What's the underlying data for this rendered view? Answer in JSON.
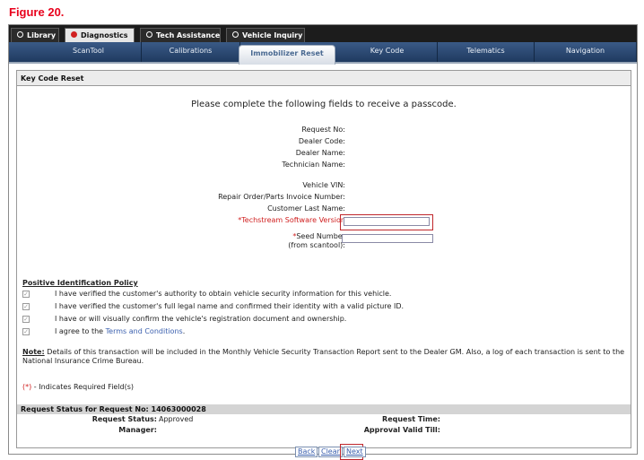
{
  "figure_title": "Figure 20.",
  "tabs": [
    {
      "label": "Library",
      "active": false
    },
    {
      "label": "Diagnostics",
      "active": true
    },
    {
      "label": "Tech Assistance",
      "active": false
    },
    {
      "label": "Vehicle Inquiry",
      "active": false
    }
  ],
  "subnav": [
    "ScanTool",
    "Calibrations",
    "Immobilizer Reset",
    "Key Code",
    "Telematics",
    "Navigation"
  ],
  "subnav_active": "Immobilizer Reset",
  "panel_title": "Key Code Reset",
  "intro": "Please complete the following fields to receive a passcode.",
  "fields": {
    "request_no": "Request No:",
    "dealer_code": "Dealer Code:",
    "dealer_name": "Dealer Name:",
    "technician_name": "Technician Name:",
    "vehicle_vin": "Vehicle VIN:",
    "repair_order": "Repair Order/Parts Invoice Number:",
    "customer_last_name": "Customer Last Name:",
    "techstream_version": "Techstream Software Version",
    "seed_number_line1": "Seed Number",
    "seed_number_line2": "(from scantool):",
    "required_marker": "*"
  },
  "policy": {
    "title": "Positive Identification Policy",
    "items": [
      "I have verified the customer's authority to obtain vehicle security information for this vehicle.",
      "I have verified the customer's full legal name and confirmed their identity with a valid picture ID.",
      "I have or will visually confirm the vehicle's registration document and ownership.",
      "I agree to the"
    ],
    "terms_link": "Terms and Conditions",
    "terms_suffix": "."
  },
  "note": {
    "label": "Note:",
    "text": "Details of this transaction will be included in the Monthly Vehicle Security Transaction Report sent to the Dealer GM. Also, a log of each transaction is sent to the National Insurance Crime Bureau."
  },
  "required_hint": {
    "marker": "(*)",
    "text": " - Indicates Required Field(s)"
  },
  "status": {
    "header": "Request Status for Request No: 14063000028",
    "request_status_label": "Request Status:",
    "request_status_value": "Approved",
    "manager_label": "Manager:",
    "request_time_label": "Request Time:",
    "approval_valid_label": "Approval Valid Till:"
  },
  "buttons": {
    "back": "Back",
    "clear": "Clear",
    "next": "Next"
  },
  "colors": {
    "figure_title": "#e8001c",
    "highlight": "#c0262b",
    "required": "#d02020",
    "link": "#3a5fae"
  }
}
